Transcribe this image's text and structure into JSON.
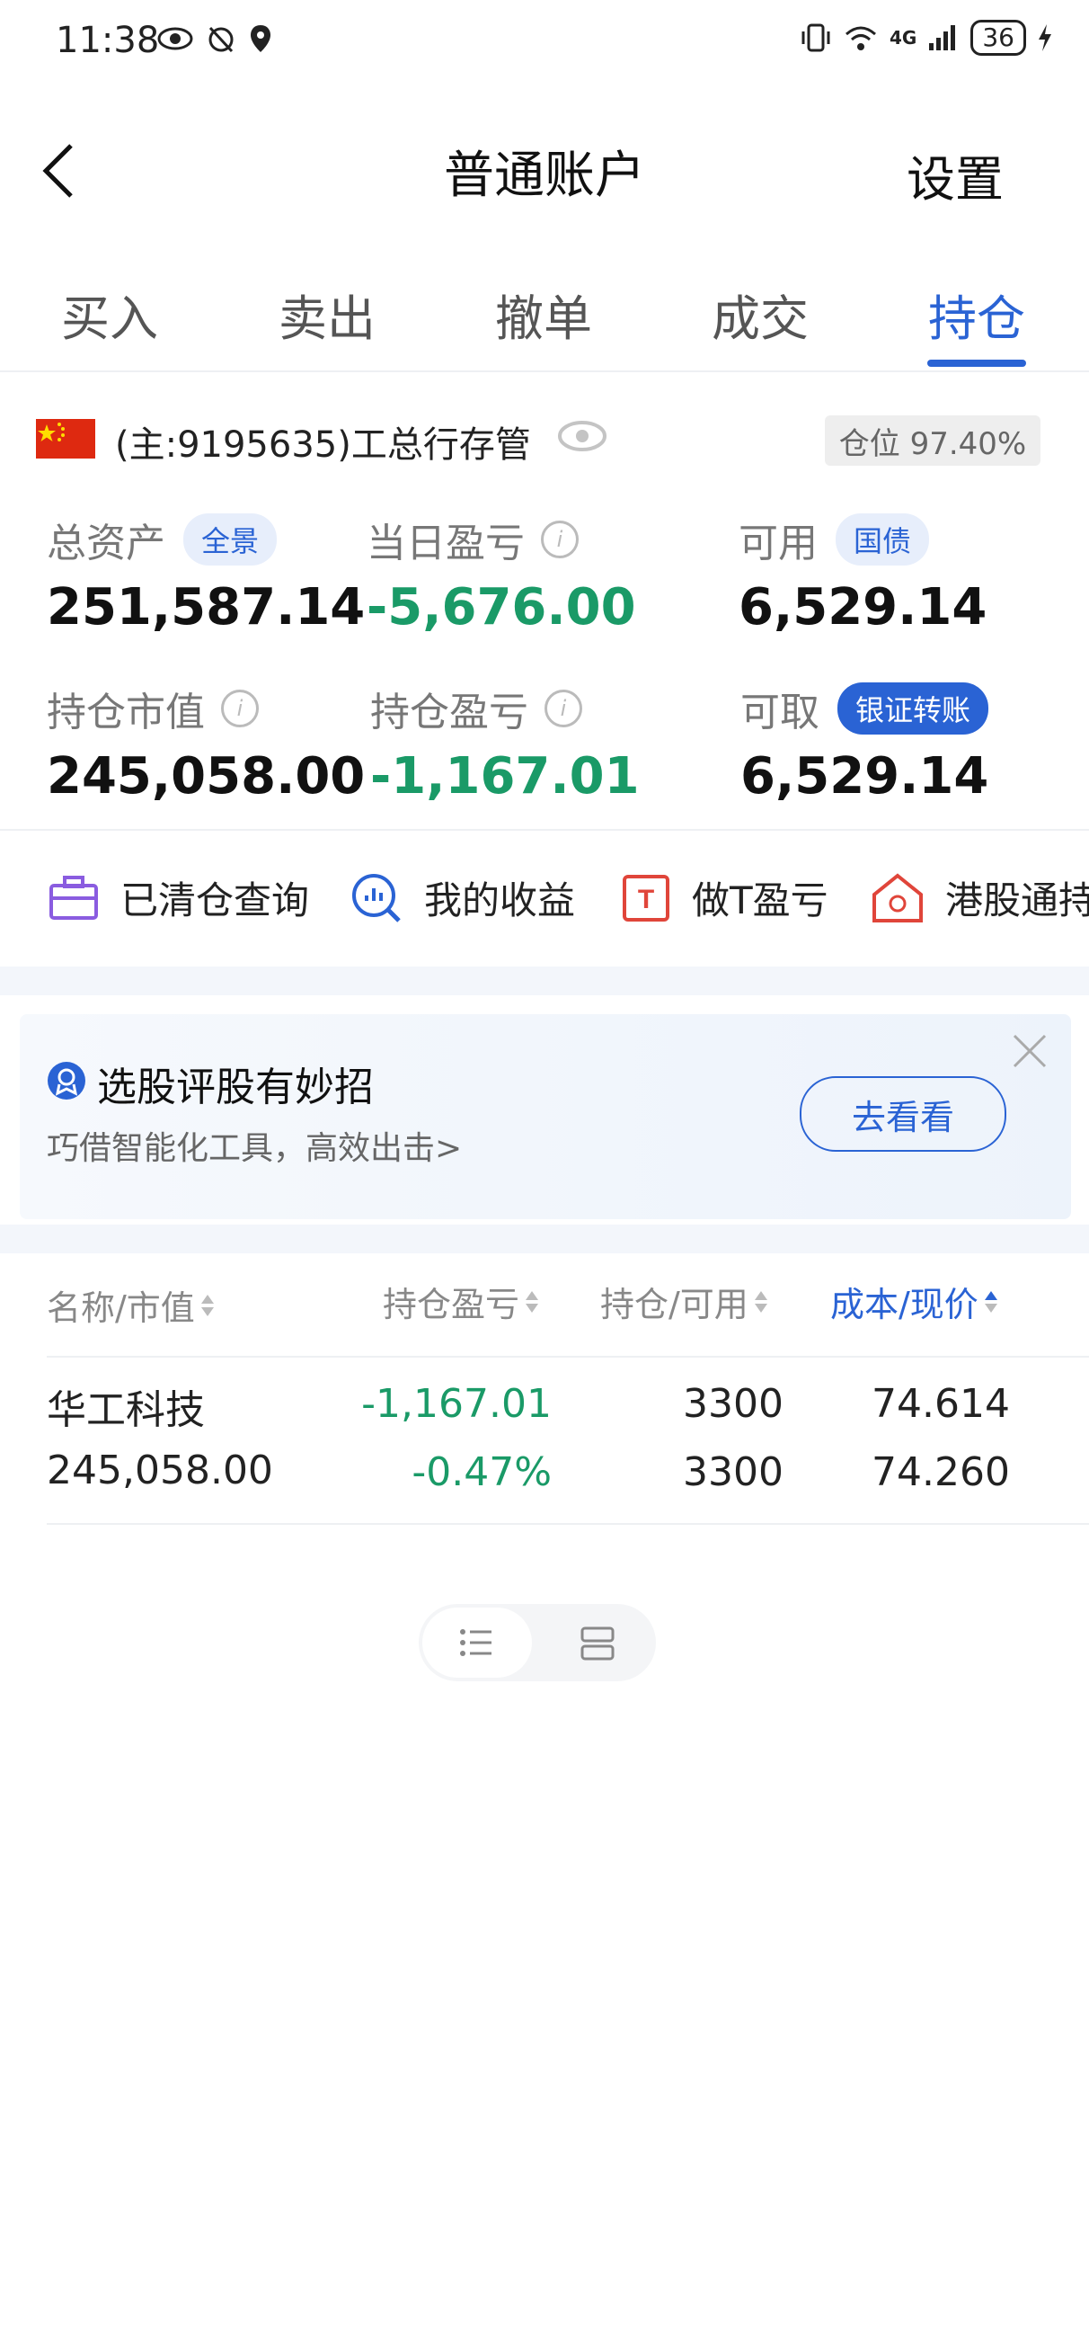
{
  "status_bar": {
    "time": "11:38",
    "network": "4G",
    "battery": "36"
  },
  "header": {
    "title": "普通账户",
    "settings_label": "设置"
  },
  "tabs": [
    {
      "label": "买入"
    },
    {
      "label": "卖出"
    },
    {
      "label": "撤单"
    },
    {
      "label": "成交"
    },
    {
      "label": "持仓",
      "active": true
    }
  ],
  "account": {
    "name": "(主:9195635)工总行存管",
    "position_label": "仓位 97.40%"
  },
  "summary": {
    "total_assets": {
      "label": "总资产",
      "chip": "全景",
      "value": "251,587.14"
    },
    "daily_pnl": {
      "label": "当日盈亏",
      "value": "-5,676.00"
    },
    "available": {
      "label": "可用",
      "chip": "国债",
      "value": "6,529.14"
    },
    "market_value": {
      "label": "持仓市值",
      "value": "245,058.00"
    },
    "position_pnl": {
      "label": "持仓盈亏",
      "value": "-1,167.01"
    },
    "withdrawable": {
      "label": "可取",
      "chip": "银证转账",
      "value": "6,529.14"
    }
  },
  "quick_actions": [
    {
      "label": "已清仓查询",
      "icon": "briefcase-icon"
    },
    {
      "label": "我的收益",
      "icon": "chart-search-icon"
    },
    {
      "label": "做T盈亏",
      "icon": "t-box-icon"
    },
    {
      "label": "港股通持",
      "icon": "hk-home-icon"
    }
  ],
  "promo": {
    "title": "选股评股有妙招",
    "subtitle": "巧借智能化工具，高效出击>",
    "button": "去看看"
  },
  "table": {
    "headers": {
      "name": "名称/市值",
      "pnl": "持仓盈亏",
      "qty": "持仓/可用",
      "cost": "成本/现价"
    },
    "rows": [
      {
        "name": "华工科技",
        "market_value": "245,058.00",
        "pnl": "-1,167.01",
        "pnl_pct": "-0.47%",
        "qty": "3300",
        "available": "3300",
        "cost": "74.614",
        "price": "74.260"
      }
    ]
  },
  "colors": {
    "accent": "#2a63d4",
    "negative": "#1a9a67"
  }
}
